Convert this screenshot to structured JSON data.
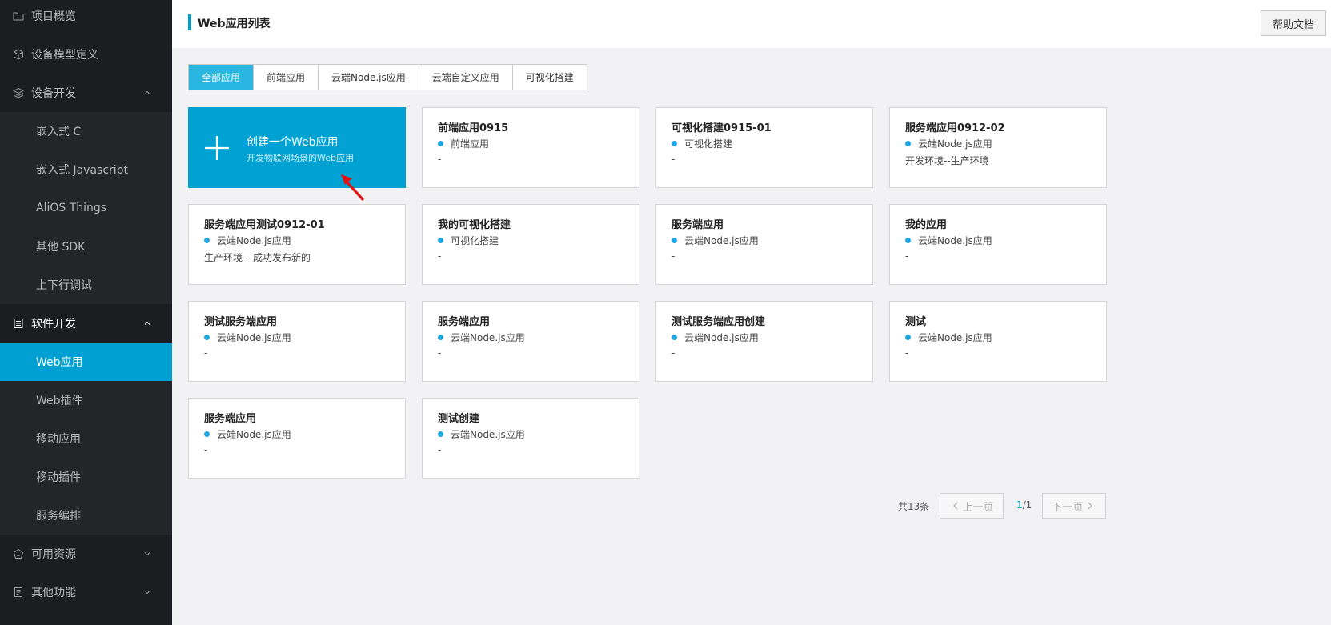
{
  "sidebar": {
    "items": [
      {
        "label": "项目概览",
        "icon": "folder-icon"
      },
      {
        "label": "设备模型定义",
        "icon": "cube-icon"
      },
      {
        "label": "设备开发",
        "icon": "layers-icon"
      },
      {
        "label": "嵌入式 C"
      },
      {
        "label": "嵌入式 Javascript"
      },
      {
        "label": "AliOS Things"
      },
      {
        "label": "其他 SDK"
      },
      {
        "label": "上下行调试"
      },
      {
        "label": "软件开发",
        "icon": "document-icon"
      },
      {
        "label": "Web应用"
      },
      {
        "label": "Web插件"
      },
      {
        "label": "移动应用"
      },
      {
        "label": "移动插件"
      },
      {
        "label": "服务编排"
      },
      {
        "label": "可用资源",
        "icon": "resource-icon"
      },
      {
        "label": "其他功能",
        "icon": "list-icon"
      }
    ]
  },
  "header": {
    "title": "Web应用列表",
    "help_label": "帮助文档"
  },
  "tabs": [
    {
      "label": "全部应用"
    },
    {
      "label": "前端应用"
    },
    {
      "label": "云端Node.js应用"
    },
    {
      "label": "云端自定义应用"
    },
    {
      "label": "可视化搭建"
    }
  ],
  "create": {
    "title": "创建一个Web应用",
    "subtitle": "开发物联网场景的Web应用"
  },
  "apps": [
    {
      "title": "前端应用0915",
      "type": "前端应用",
      "desc": "-"
    },
    {
      "title": "可视化搭建0915-01",
      "type": "可视化搭建",
      "desc": "-"
    },
    {
      "title": "服务端应用0912-02",
      "type": "云端Node.js应用",
      "desc": "开发环境--生产环境"
    },
    {
      "title": "服务端应用测试0912-01",
      "type": "云端Node.js应用",
      "desc": "生产环境---成功发布新的"
    },
    {
      "title": "我的可视化搭建",
      "type": "可视化搭建",
      "desc": "-"
    },
    {
      "title": "服务端应用",
      "type": "云端Node.js应用",
      "desc": "-"
    },
    {
      "title": "我的应用",
      "type": "云端Node.js应用",
      "desc": "-"
    },
    {
      "title": "测试服务端应用",
      "type": "云端Node.js应用",
      "desc": "-"
    },
    {
      "title": "服务端应用",
      "type": "云端Node.js应用",
      "desc": "-"
    },
    {
      "title": "测试服务端应用创建",
      "type": "云端Node.js应用",
      "desc": "-"
    },
    {
      "title": "测试",
      "type": "云端Node.js应用",
      "desc": "-"
    },
    {
      "title": "服务端应用",
      "type": "云端Node.js应用",
      "desc": "-"
    },
    {
      "title": "测试创建",
      "type": "云端Node.js应用",
      "desc": "-"
    }
  ],
  "pagination": {
    "total": "共13条",
    "prev": "上一页",
    "current": "1",
    "pages": "/1",
    "next": "下一页"
  },
  "colors": {
    "accent": "#00a0d2",
    "sidebar_bg": "#1c1d20",
    "dot": "#1fa7e0"
  }
}
